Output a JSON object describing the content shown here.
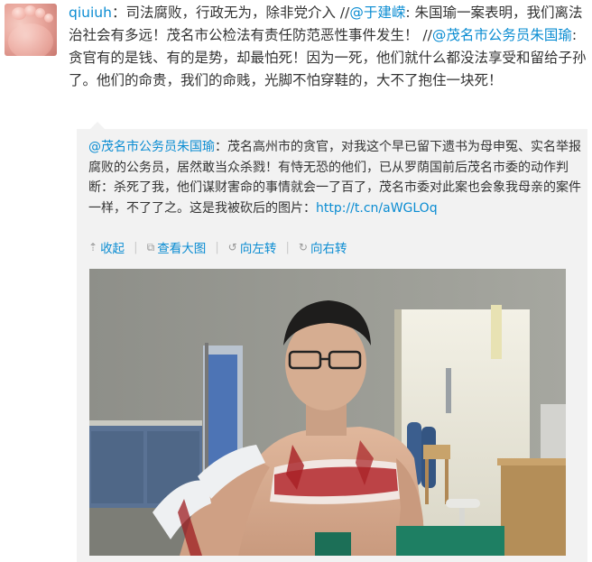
{
  "post": {
    "username": "qiuiuh",
    "colon": "：",
    "text1": "司法腐败，行政无为，除非党介入 //",
    "mention1": "@于建嵘",
    "text2": ": 朱国瑜一案表明，我们离法治社会有多远！茂名市公检法有责任防范恶性事件发生！ //",
    "mention2": "@茂名市公务员朱国瑜",
    "text3": ":贪官有的是钱、有的是势，却最怕死！因为一死，他们就什么都没法享受和留给子孙了。他们的命贵，我们的命贱，光脚不怕穿鞋的，大不了抱住一块死！"
  },
  "quote": {
    "author": "@茂名市公务员朱国瑜",
    "text": "：茂名高州市的贪官，对我这个早已留下遗书为母申冤、实名举报腐败的公务员，居然敢当众杀戮！有恃无恐的他们，已从罗荫国前后茂名市委的动作判断：杀死了我，他们谋财害命的事情就会一了百了，茂名市委对此案也会象我母亲的案件一样，不了了之。这是我被砍后的图片：",
    "link": "http://t.cn/aWGLOq"
  },
  "toolbar": {
    "collapse": "收起",
    "view_large": "查看大图",
    "rotate_left": "向左转",
    "rotate_right": "向右转"
  },
  "icons": {
    "collapse": "arrow-up-icon",
    "view_large": "external-view-icon",
    "rotate_left": "rotate-left-icon",
    "rotate_right": "rotate-right-icon"
  },
  "colors": {
    "link": "#0a8cd2",
    "quote_bg": "#f2f2f2"
  }
}
